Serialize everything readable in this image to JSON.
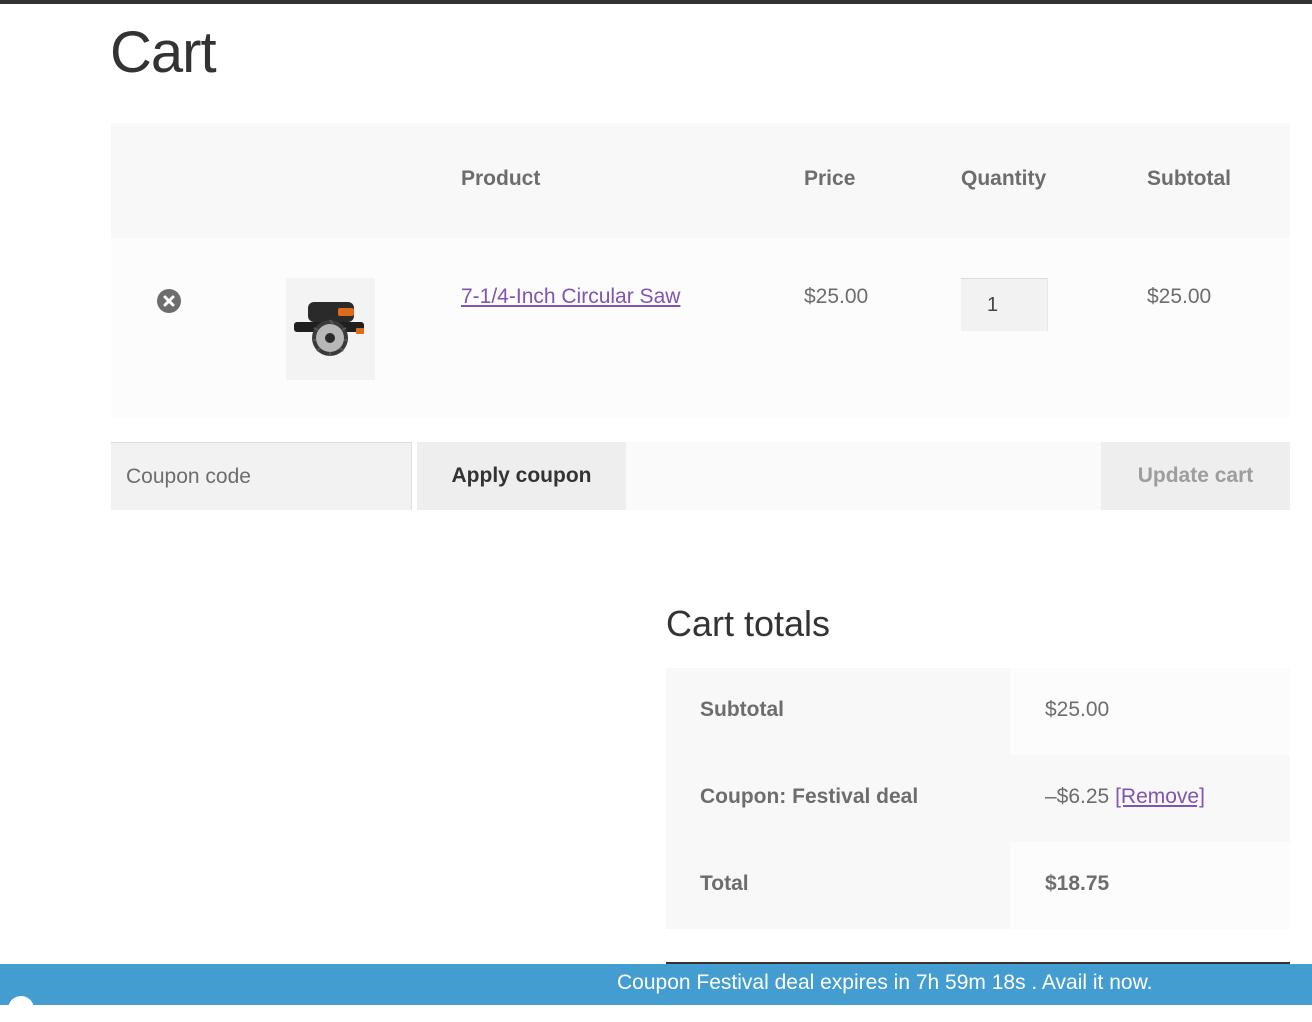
{
  "page": {
    "title": "Cart"
  },
  "cart_table": {
    "headers": {
      "product": "Product",
      "price": "Price",
      "quantity": "Quantity",
      "subtotal": "Subtotal"
    },
    "items": [
      {
        "name": "7-1/4-Inch Circular Saw",
        "price": "$25.00",
        "quantity": "1",
        "subtotal": "$25.00",
        "thumbnail_icon": "circular-saw-image",
        "remove_icon": "remove-circle-icon"
      }
    ]
  },
  "actions": {
    "coupon_placeholder": "Coupon code",
    "apply_coupon": "Apply coupon",
    "update_cart": "Update cart"
  },
  "totals": {
    "title": "Cart totals",
    "subtotal_label": "Subtotal",
    "subtotal_value": "$25.00",
    "coupon_label": "Coupon: Festival deal",
    "coupon_value": "–$6.25",
    "coupon_remove": "[Remove]",
    "total_label": "Total",
    "total_value": "$18.75"
  },
  "banner": {
    "text": "Coupon Festival deal expires in 7h 59m 18s . Avail it now."
  },
  "colors": {
    "link": "#7f54b3",
    "banner": "#449dd1",
    "text": "#6d6d6d",
    "heading": "#333333"
  }
}
